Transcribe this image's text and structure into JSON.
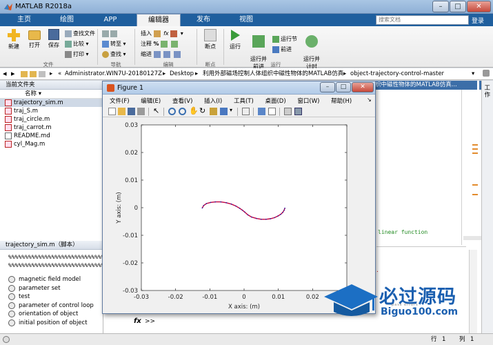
{
  "window": {
    "title": "MATLAB R2018a"
  },
  "tabs": [
    {
      "label": "主页"
    },
    {
      "label": "绘图"
    },
    {
      "label": "APP"
    },
    {
      "label": "编辑器"
    },
    {
      "label": "发布"
    },
    {
      "label": "视图"
    }
  ],
  "search": {
    "placeholder": "搜索文档",
    "login": "登录"
  },
  "ribbon": {
    "file": {
      "new": "新建",
      "open": "打开",
      "save": "保存",
      "find_files": "查找文件",
      "compare": "比较",
      "print": "打印",
      "group": "文件"
    },
    "nav": {
      "goto": "转至",
      "find": "查找",
      "group": "导航"
    },
    "edit": {
      "insert": "插入",
      "comment": "注释",
      "indent": "缩进",
      "fx": "fx",
      "group": "编辑"
    },
    "breakpoints": {
      "breakpoint": "断点",
      "group": "断点"
    },
    "run": {
      "run": "运行",
      "run_advance": "运行并\n前进",
      "run_section": "运行节",
      "advance": "前进",
      "run_time": "运行并\n计时",
      "group": "运行"
    }
  },
  "path": {
    "segments": [
      "Administrator.WIN7U-20180127Z",
      "Desktop",
      "利用外部磁场控制人体组织中磁性物体的MATLAB仿真",
      "object-trajectory-control-master"
    ]
  },
  "file_panel": {
    "title": "当前文件夹",
    "column": "名称",
    "files": [
      {
        "name": "trajectory_sim.m"
      },
      {
        "name": "traj_S.m"
      },
      {
        "name": "traj_circle.m"
      },
      {
        "name": "traj_carrot.m"
      },
      {
        "name": "README.md"
      },
      {
        "name": "cyl_Mag.m"
      }
    ]
  },
  "details_panel": {
    "title": "trajectory_sim.m（脚本）",
    "comment_line1": "%%%%%%%%%%%%%%%%%%%%%%%%%%%%%%%%",
    "comment_line2": "%%%%%%%%%%%%%%%%%%%%%%%%%%%%%%%%",
    "sections": [
      {
        "label": "magnetic field model"
      },
      {
        "label": "parameter set"
      },
      {
        "label": "test"
      },
      {
        "label": "parameter of control loop"
      },
      {
        "label": "orientation of object"
      },
      {
        "label": "initial position of object"
      }
    ]
  },
  "editor": {
    "tab_fragment": "织中磁性物体的MATLAB仿真...",
    "code_fragment": "linear function"
  },
  "workspace_label": "工作",
  "command": {
    "prompt": ">>",
    "fx": "fx"
  },
  "status": {
    "row_label": "行",
    "row": "1",
    "col_label": "列",
    "col": "1"
  },
  "figure": {
    "title": "Figure 1",
    "menu": [
      "文件(F)",
      "编辑(E)",
      "查看(V)",
      "插入(I)",
      "工具(T)",
      "桌面(D)",
      "窗口(W)",
      "帮助(H)"
    ]
  },
  "watermark": {
    "main": "必过源码",
    "sub": "Biguo100.com",
    "tiny": "pass errors"
  },
  "chart_data": {
    "type": "line",
    "xlabel": "X axis: (m)",
    "ylabel": "Y axis: (m)",
    "xlim": [
      -0.03,
      0.03
    ],
    "ylim": [
      -0.03,
      0.03
    ],
    "xticks": [
      "-0.03",
      "-0.02",
      "-0.01",
      "0",
      "0.01",
      "0.02",
      "0.03"
    ],
    "yticks": [
      "-0.03",
      "-0.02",
      "-0.01",
      "0",
      "0.01",
      "0.02",
      "0.03"
    ],
    "grid": false,
    "series": [
      {
        "color": "#c00040",
        "x": [
          -0.0122,
          -0.0118,
          -0.011,
          -0.0098,
          -0.0084,
          -0.0068,
          -0.0052,
          -0.0037,
          -0.0024,
          -0.0013,
          -0.0005,
          0.0002,
          0.0011,
          0.0022,
          0.0036,
          0.005,
          0.0064,
          0.0077,
          0.0089,
          0.0099,
          0.0107,
          0.0113,
          0.0117,
          0.0119
        ],
        "y": [
          -0.0001,
          0.0008,
          0.0015,
          0.0019,
          0.0021,
          0.0021,
          0.0018,
          0.0013,
          0.0006,
          -0.0002,
          -0.0009,
          -0.0016,
          -0.0026,
          -0.0034,
          -0.0039,
          -0.0042,
          -0.0042,
          -0.004,
          -0.0036,
          -0.003,
          -0.0024,
          -0.0017,
          -0.0009,
          -0.0002
        ]
      }
    ]
  }
}
